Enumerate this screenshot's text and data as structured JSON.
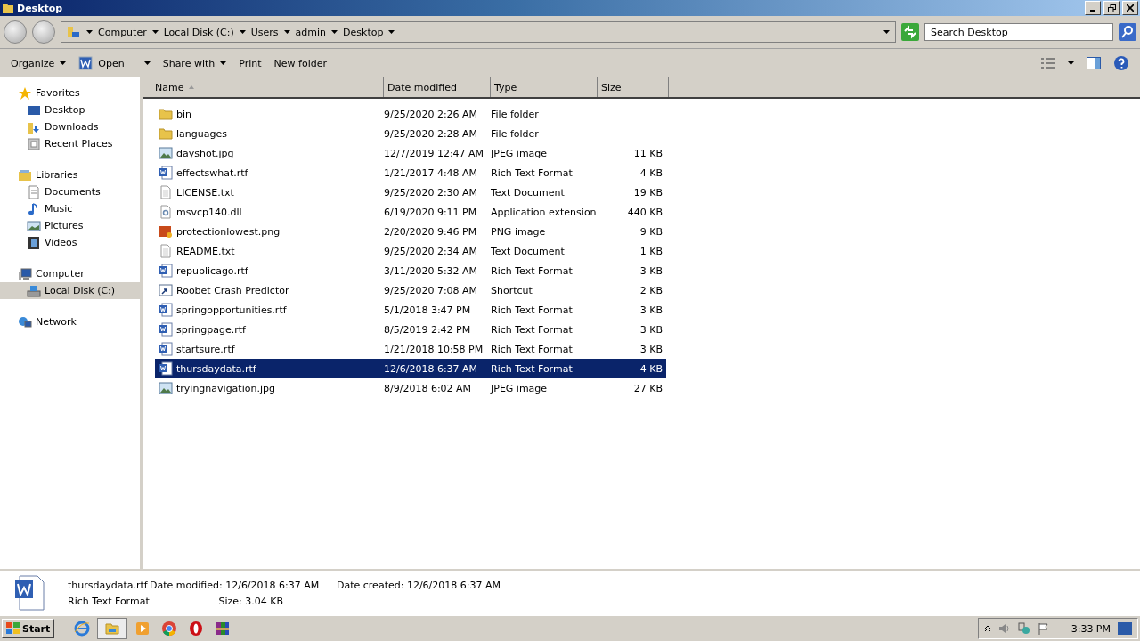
{
  "window": {
    "title": "Desktop"
  },
  "breadcrumb": [
    "Computer",
    "Local Disk (C:)",
    "Users",
    "admin",
    "Desktop"
  ],
  "search": {
    "placeholder": "Search Desktop"
  },
  "toolbar": [
    {
      "label": "Organize",
      "kind": "menu"
    },
    {
      "label": "Open",
      "kind": "open"
    },
    {
      "label": "Share with",
      "kind": "menu"
    },
    {
      "label": "Print",
      "kind": "plain"
    },
    {
      "label": "New folder",
      "kind": "plain"
    }
  ],
  "sidebar": [
    {
      "label": "Favorites",
      "kind": "star",
      "selected": false,
      "children": [
        {
          "label": "Desktop",
          "kind": "desktop",
          "selected": false
        },
        {
          "label": "Downloads",
          "kind": "downloads",
          "selected": false
        },
        {
          "label": "Recent Places",
          "kind": "recent",
          "selected": false
        }
      ]
    },
    {
      "label": "Libraries",
      "kind": "library",
      "selected": false,
      "children": [
        {
          "label": "Documents",
          "kind": "documents",
          "selected": false
        },
        {
          "label": "Music",
          "kind": "music",
          "selected": false
        },
        {
          "label": "Pictures",
          "kind": "pictures",
          "selected": false
        },
        {
          "label": "Videos",
          "kind": "videos",
          "selected": false
        }
      ]
    },
    {
      "label": "Computer",
      "kind": "computer",
      "selected": false,
      "children": [
        {
          "label": "Local Disk (C:)",
          "kind": "disk",
          "selected": true
        }
      ]
    },
    {
      "label": "Network",
      "kind": "network",
      "selected": false
    }
  ],
  "table": {
    "columns": [
      "Name",
      "Date modified",
      "Type",
      "Size"
    ],
    "rows": [
      {
        "name": "bin",
        "date": "9/25/2020 2:26 AM",
        "type": "File folder",
        "size": "",
        "kind": "folder",
        "selected": false
      },
      {
        "name": "languages",
        "date": "9/25/2020 2:28 AM",
        "type": "File folder",
        "size": "",
        "kind": "folder",
        "selected": false
      },
      {
        "name": "dayshot.jpg",
        "date": "12/7/2019 12:47 AM",
        "type": "JPEG image",
        "size": "11 KB",
        "kind": "image",
        "selected": false
      },
      {
        "name": "effectswhat.rtf",
        "date": "1/21/2017 4:48 AM",
        "type": "Rich Text Format",
        "size": "4 KB",
        "kind": "rtf",
        "selected": false
      },
      {
        "name": "LICENSE.txt",
        "date": "9/25/2020 2:30 AM",
        "type": "Text Document",
        "size": "19 KB",
        "kind": "text",
        "selected": false
      },
      {
        "name": "msvcp140.dll",
        "date": "6/19/2020 9:11 PM",
        "type": "Application extension",
        "size": "440 KB",
        "kind": "dll",
        "selected": false
      },
      {
        "name": "protectionlowest.png",
        "date": "2/20/2020 9:46 PM",
        "type": "PNG image",
        "size": "9 KB",
        "kind": "png",
        "selected": false
      },
      {
        "name": "README.txt",
        "date": "9/25/2020 2:34 AM",
        "type": "Text Document",
        "size": "1 KB",
        "kind": "text",
        "selected": false
      },
      {
        "name": "republicago.rtf",
        "date": "3/11/2020 5:32 AM",
        "type": "Rich Text Format",
        "size": "3 KB",
        "kind": "rtf",
        "selected": false
      },
      {
        "name": "Roobet Crash Predictor",
        "date": "9/25/2020 7:08 AM",
        "type": "Shortcut",
        "size": "2 KB",
        "kind": "shortcut",
        "selected": false
      },
      {
        "name": "springopportunities.rtf",
        "date": "5/1/2018 3:47 PM",
        "type": "Rich Text Format",
        "size": "3 KB",
        "kind": "rtf",
        "selected": false
      },
      {
        "name": "springpage.rtf",
        "date": "8/5/2019 2:42 PM",
        "type": "Rich Text Format",
        "size": "3 KB",
        "kind": "rtf",
        "selected": false
      },
      {
        "name": "startsure.rtf",
        "date": "1/21/2018 10:58 PM",
        "type": "Rich Text Format",
        "size": "3 KB",
        "kind": "rtf",
        "selected": false
      },
      {
        "name": "thursdaydata.rtf",
        "date": "12/6/2018 6:37 AM",
        "type": "Rich Text Format",
        "size": "4 KB",
        "kind": "rtf",
        "selected": true
      },
      {
        "name": "tryingnavigation.jpg",
        "date": "8/9/2018 6:02 AM",
        "type": "JPEG image",
        "size": "27 KB",
        "kind": "image",
        "selected": false
      }
    ]
  },
  "details": {
    "name": "thursdaydata.rtf",
    "type": "Rich Text Format",
    "modified_label": "Date modified:",
    "modified": "12/6/2018 6:37 AM",
    "created_label": "Date created:",
    "created": "12/6/2018 6:37 AM",
    "size_label": "Size:",
    "size": "3.04 KB"
  },
  "taskbar": {
    "start": "Start",
    "apps": [
      {
        "kind": "ie",
        "selected": false
      },
      {
        "kind": "explorer",
        "selected": true
      },
      {
        "kind": "media",
        "selected": false
      },
      {
        "kind": "chrome",
        "selected": false
      },
      {
        "kind": "opera",
        "selected": false
      },
      {
        "kind": "winrar",
        "selected": false
      }
    ],
    "clock": "3:33 PM"
  }
}
